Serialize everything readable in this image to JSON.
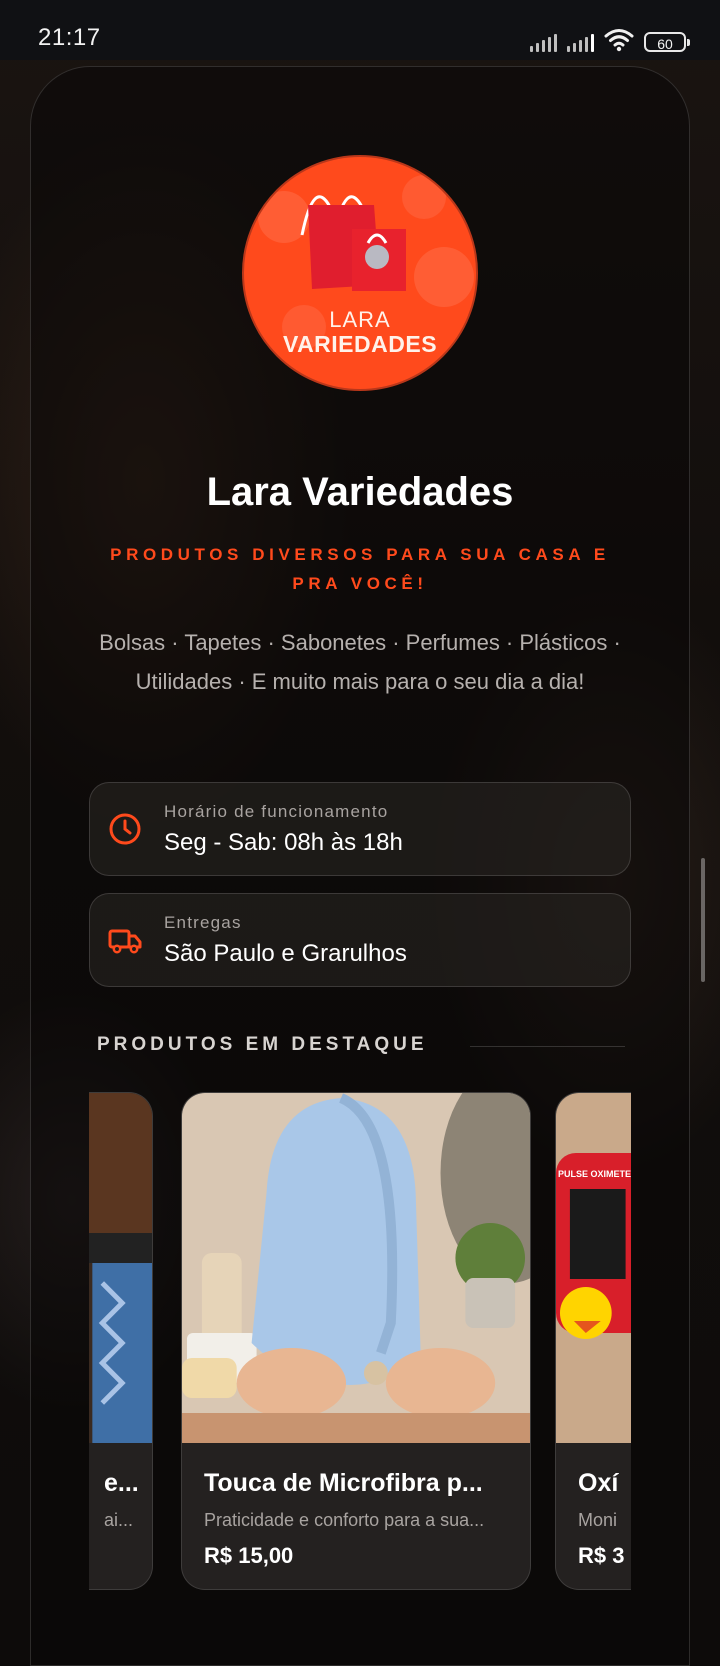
{
  "status_bar": {
    "time": "21:17",
    "battery": "60"
  },
  "store": {
    "logo_text_line1": "LARA",
    "logo_text_line2": "VARIEDADES",
    "name": "Lara Variedades",
    "tagline": "PRODUTOS DIVERSOS PARA SUA CASA E PRA VOCÊ!",
    "description": "Bolsas · Tapetes · Sabonetes · Perfumes · Plásticos · Utilidades · E muito mais para o seu dia a dia!"
  },
  "info": {
    "hours_label": "Horário de funcionamento",
    "hours_value": "Seg - Sab: 08h às 18h",
    "delivery_label": "Entregas",
    "delivery_value": "São Paulo e Grarulhos"
  },
  "featured": {
    "title": "PRODUTOS EM DESTAQUE",
    "products": [
      {
        "name": "e...",
        "description": "ai...",
        "price": ""
      },
      {
        "name": "Touca de Microfibra p...",
        "description": "Praticidade e conforto para a sua...",
        "price": "R$ 15,00"
      },
      {
        "name": "Oxí",
        "description": "Moni",
        "price": "R$ 3",
        "image_label": "PULSE OXIMETE"
      }
    ]
  },
  "colors": {
    "accent": "#ff4a1c",
    "background": "#0d0b0a",
    "card": "#242120"
  }
}
